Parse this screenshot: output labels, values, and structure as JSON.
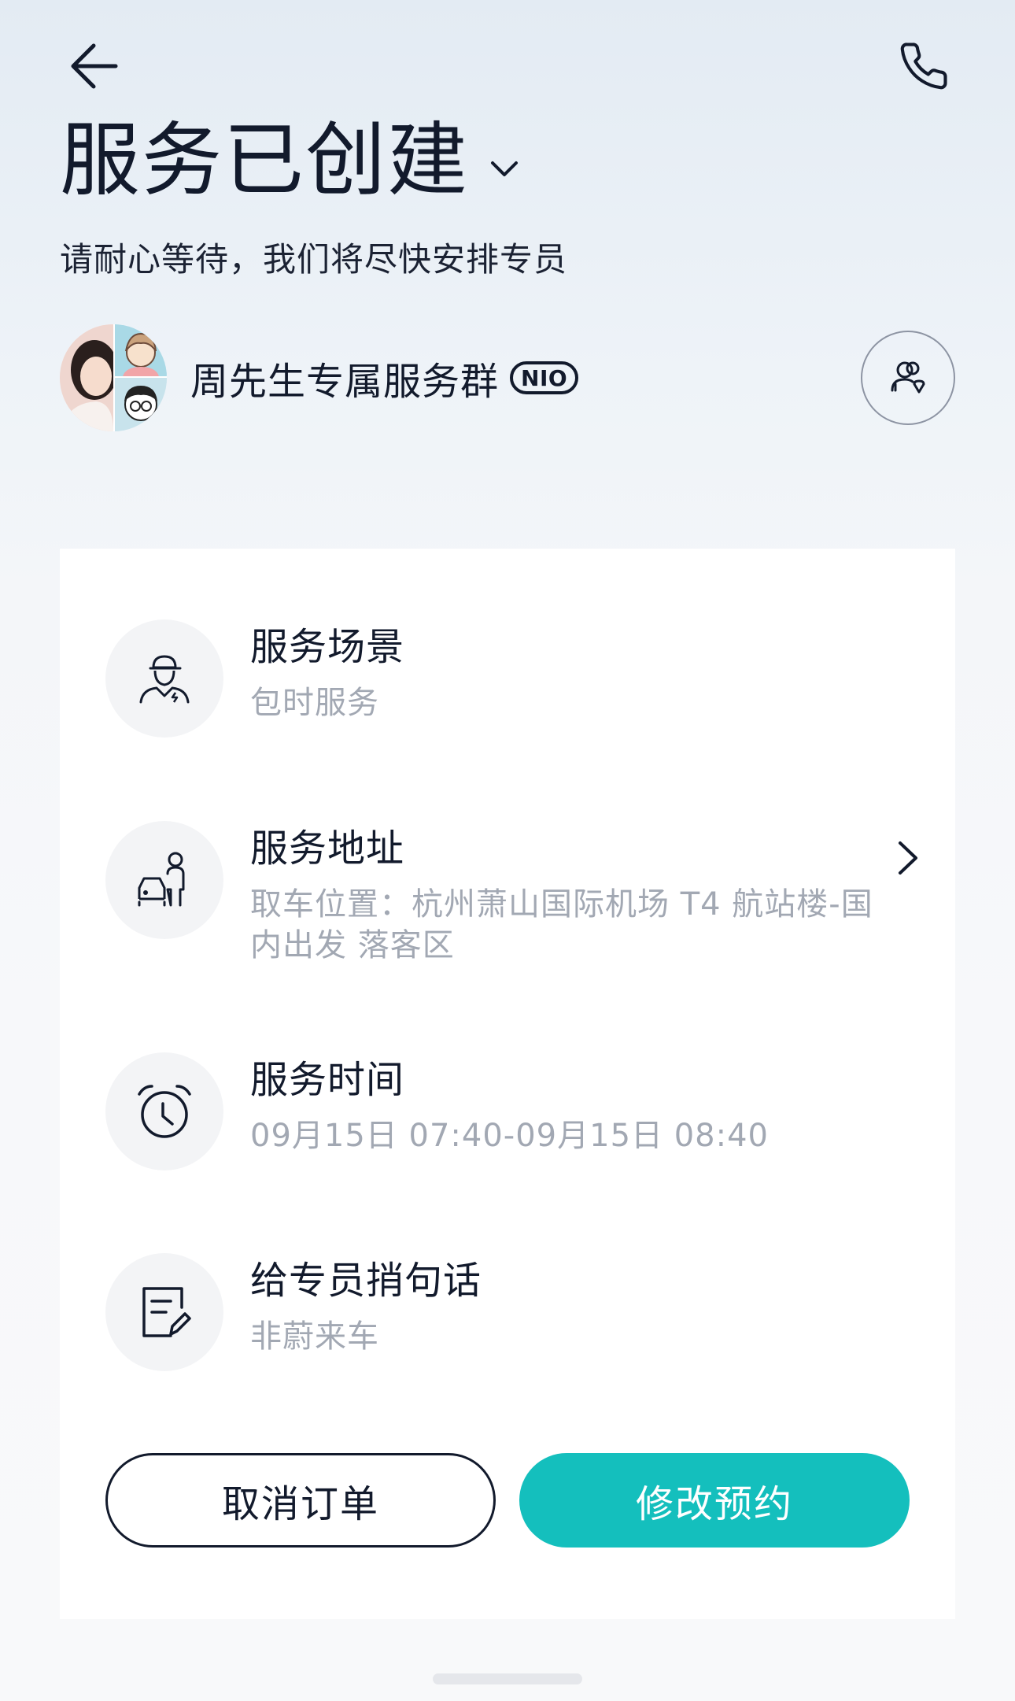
{
  "header": {
    "title": "服务已创建",
    "subtitle": "请耐心等待，我们将尽快安排专员"
  },
  "group": {
    "name": "周先生专属服务群",
    "badge": "NIO"
  },
  "details": [
    {
      "label": "服务场景",
      "value": "包时服务",
      "icon": "driver-icon"
    },
    {
      "label": "服务地址",
      "value": "取车位置：杭州萧山国际机场 T4 航站楼-国内出发 落客区",
      "icon": "car-person-icon"
    },
    {
      "label": "服务时间",
      "value": "09月15日 07:40-09月15日 08:40",
      "icon": "alarm-clock-icon"
    },
    {
      "label": "给专员捎句话",
      "value": "非蔚来车",
      "icon": "note-edit-icon"
    }
  ],
  "actions": {
    "cancel_label": "取消订单",
    "modify_label": "修改预约"
  },
  "colors": {
    "accent": "#14bfbd",
    "text": "#121a2c",
    "muted": "#a2a8b3"
  }
}
